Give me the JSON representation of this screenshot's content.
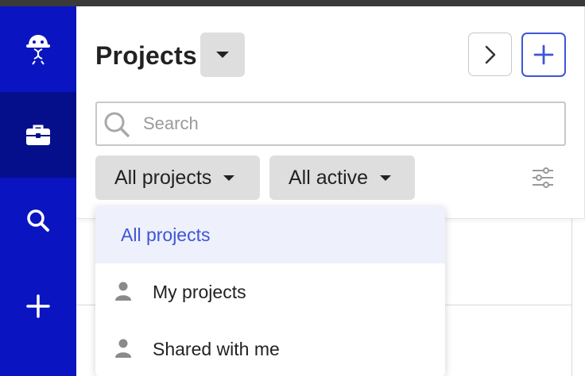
{
  "colors": {
    "sidebar": "#0a14c0",
    "sidebar_active": "#050f8c",
    "accent": "#3f55d6",
    "chip_bg": "#dedede",
    "selected_bg": "#eef0fc"
  },
  "sidebar": {
    "items": [
      {
        "name": "logo",
        "icon": "mascot-logo-icon",
        "active": false
      },
      {
        "name": "projects",
        "icon": "briefcase-icon",
        "active": true
      },
      {
        "name": "search",
        "icon": "search-icon",
        "active": false
      },
      {
        "name": "add",
        "icon": "plus-icon",
        "active": false
      }
    ]
  },
  "header": {
    "title": "Projects",
    "title_dropdown_icon": "caret-down-icon",
    "next_icon": "chevron-right-icon",
    "add_icon": "plus-icon"
  },
  "search": {
    "placeholder": "Search",
    "value": ""
  },
  "filters": {
    "scope": {
      "label": "All projects",
      "icon": "caret-down-icon"
    },
    "status": {
      "label": "All active",
      "icon": "caret-down-icon"
    },
    "settings_icon": "sliders-icon"
  },
  "dropdown": {
    "items": [
      {
        "label": "All projects",
        "selected": true,
        "icon": ""
      },
      {
        "label": "My projects",
        "selected": false,
        "icon": "person-icon"
      },
      {
        "label": "Shared with me",
        "selected": false,
        "icon": "person-icon"
      }
    ]
  }
}
